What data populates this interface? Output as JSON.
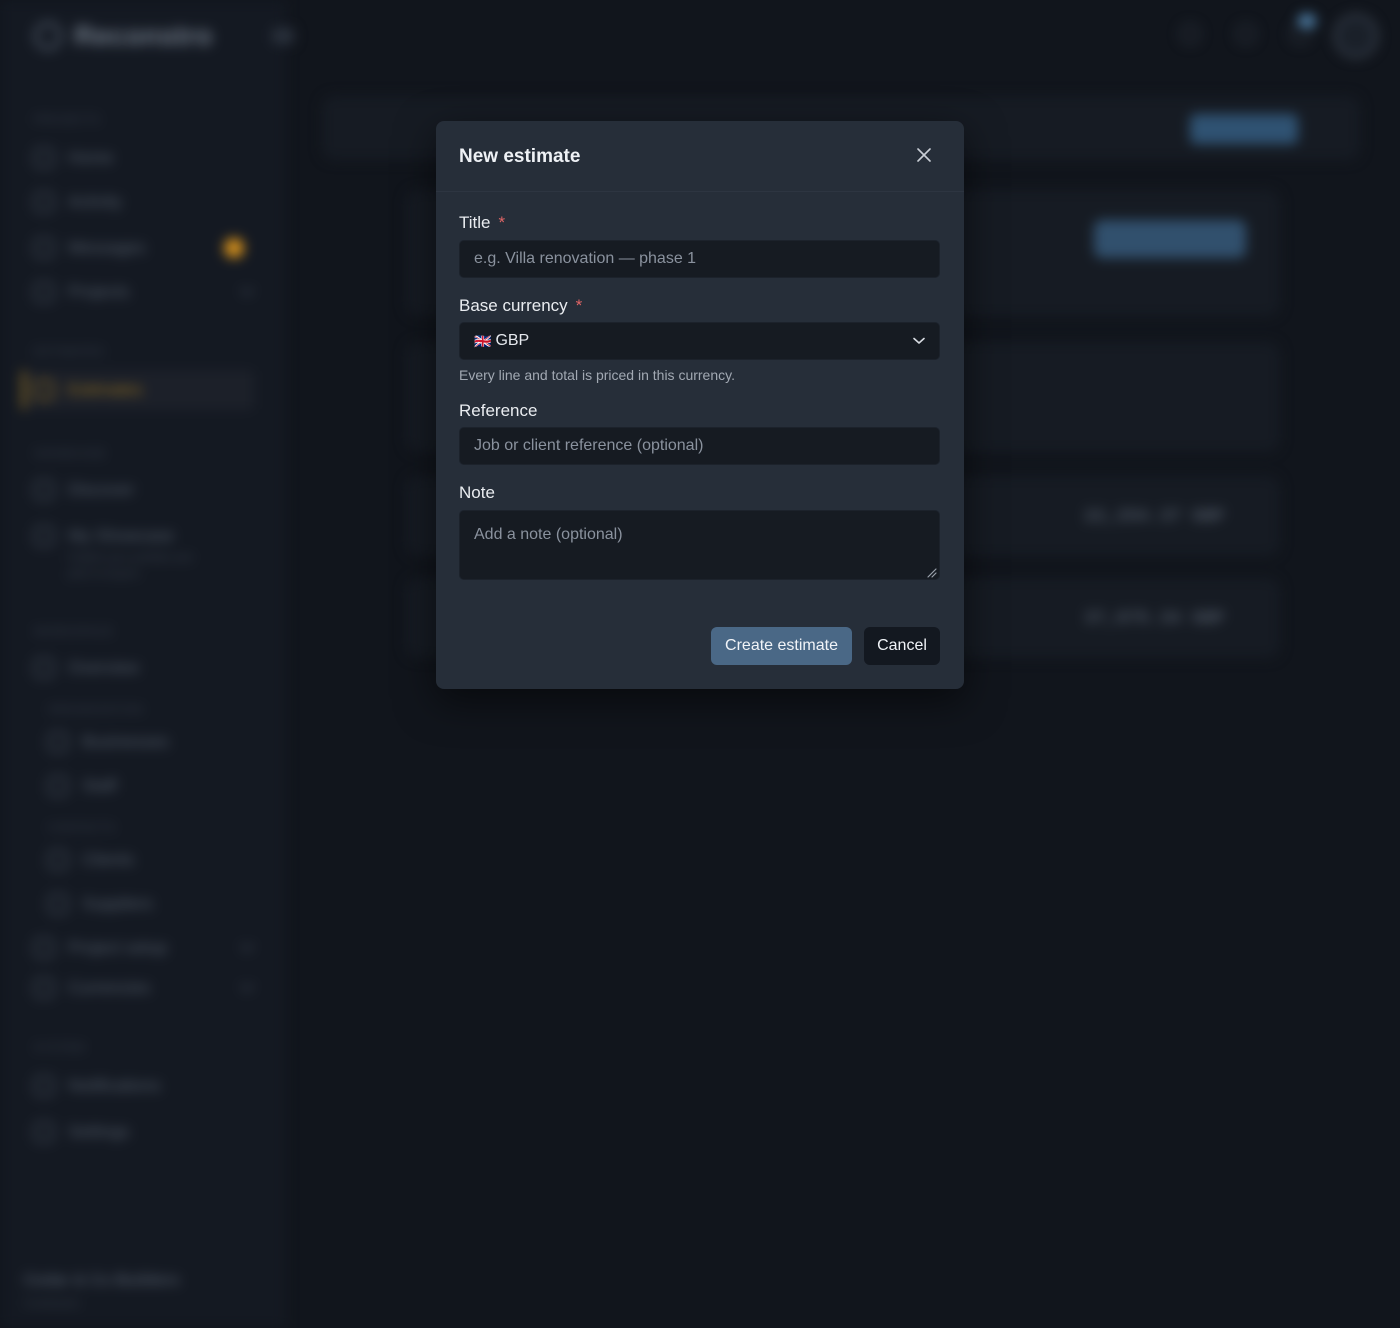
{
  "background": {
    "app_name": "Reconstro",
    "sections": {
      "projects": "PROJECTS",
      "estimates": "ESTIMATES",
      "showcase": "SHOWCASE",
      "workspace": "WORKSPACE",
      "organisation": "ORGANISATION",
      "contacts": "CONTACTS",
      "system": "SYSTEM"
    },
    "nav": {
      "home": "Home",
      "activity": "Activity",
      "messages": "Messages",
      "projects": "Projects",
      "estimates": "Estimates",
      "discover": "Discover",
      "my_showcase": "My Showcase",
      "my_showcase_desc": "Publish your portfolio and pitch to buyers",
      "overview": "Overview",
      "businesses": "Businesses",
      "staff": "Staff",
      "clients": "Clients",
      "suppliers": "Suppliers",
      "project_setup": "Project setup",
      "currencies": "Currencies",
      "notifications": "Notifications",
      "settings": "Settings"
    },
    "footer": {
      "org": "Cedar & Co Builders",
      "role": "Contractor"
    },
    "amounts": [
      "22,254.37 GBP",
      "37,875.34 GBP"
    ]
  },
  "modal": {
    "title": "New estimate",
    "close_label": "×",
    "fields": {
      "title": {
        "label": "Title",
        "required_mark": "*",
        "placeholder": "e.g. Villa renovation — phase 1",
        "value": ""
      },
      "base_currency": {
        "label": "Base currency",
        "required_mark": "*",
        "flag": "🇬🇧",
        "value": "GBP",
        "hint": "Every line and total is priced in this currency."
      },
      "reference": {
        "label": "Reference",
        "placeholder": "Job or client reference (optional)",
        "value": ""
      },
      "note": {
        "label": "Note",
        "placeholder": "Add a note (optional)",
        "value": ""
      }
    },
    "actions": {
      "create": "Create estimate",
      "cancel": "Cancel"
    }
  }
}
